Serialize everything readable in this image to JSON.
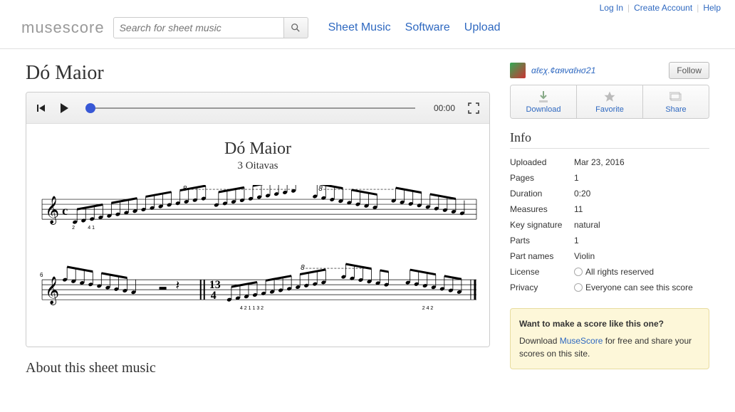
{
  "topbar": {
    "login": "Log In",
    "create": "Create Account",
    "help": "Help"
  },
  "header": {
    "logo": "musescore",
    "search_placeholder": "Search for sheet music",
    "nav": {
      "sheet": "Sheet Music",
      "software": "Software",
      "upload": "Upload"
    }
  },
  "score": {
    "title": "Dó Maior",
    "sheet_title": "Dó Maior",
    "sheet_subtitle": "3 Oitavas",
    "time": "00:00"
  },
  "about_header": "About this sheet music",
  "uploader": {
    "name": "αℓєχ.¢αяναℓнσ21",
    "follow": "Follow"
  },
  "actions": {
    "download": "Download",
    "favorite": "Favorite",
    "share": "Share"
  },
  "info": {
    "header": "Info",
    "rows": [
      {
        "k": "Uploaded",
        "v": "Mar 23, 2016"
      },
      {
        "k": "Pages",
        "v": "1"
      },
      {
        "k": "Duration",
        "v": "0:20"
      },
      {
        "k": "Measures",
        "v": "11"
      },
      {
        "k": "Key signature",
        "v": "natural"
      },
      {
        "k": "Parts",
        "v": "1"
      },
      {
        "k": "Part names",
        "v": "Violin"
      },
      {
        "k": "License",
        "v": "All rights reserved",
        "icon": true
      },
      {
        "k": "Privacy",
        "v": "Everyone can see this score",
        "icon": true
      }
    ]
  },
  "promo": {
    "q": "Want to make a score like this one?",
    "pre": "Download ",
    "link": "MuseScore",
    "post": " for free and share your scores on this site."
  }
}
